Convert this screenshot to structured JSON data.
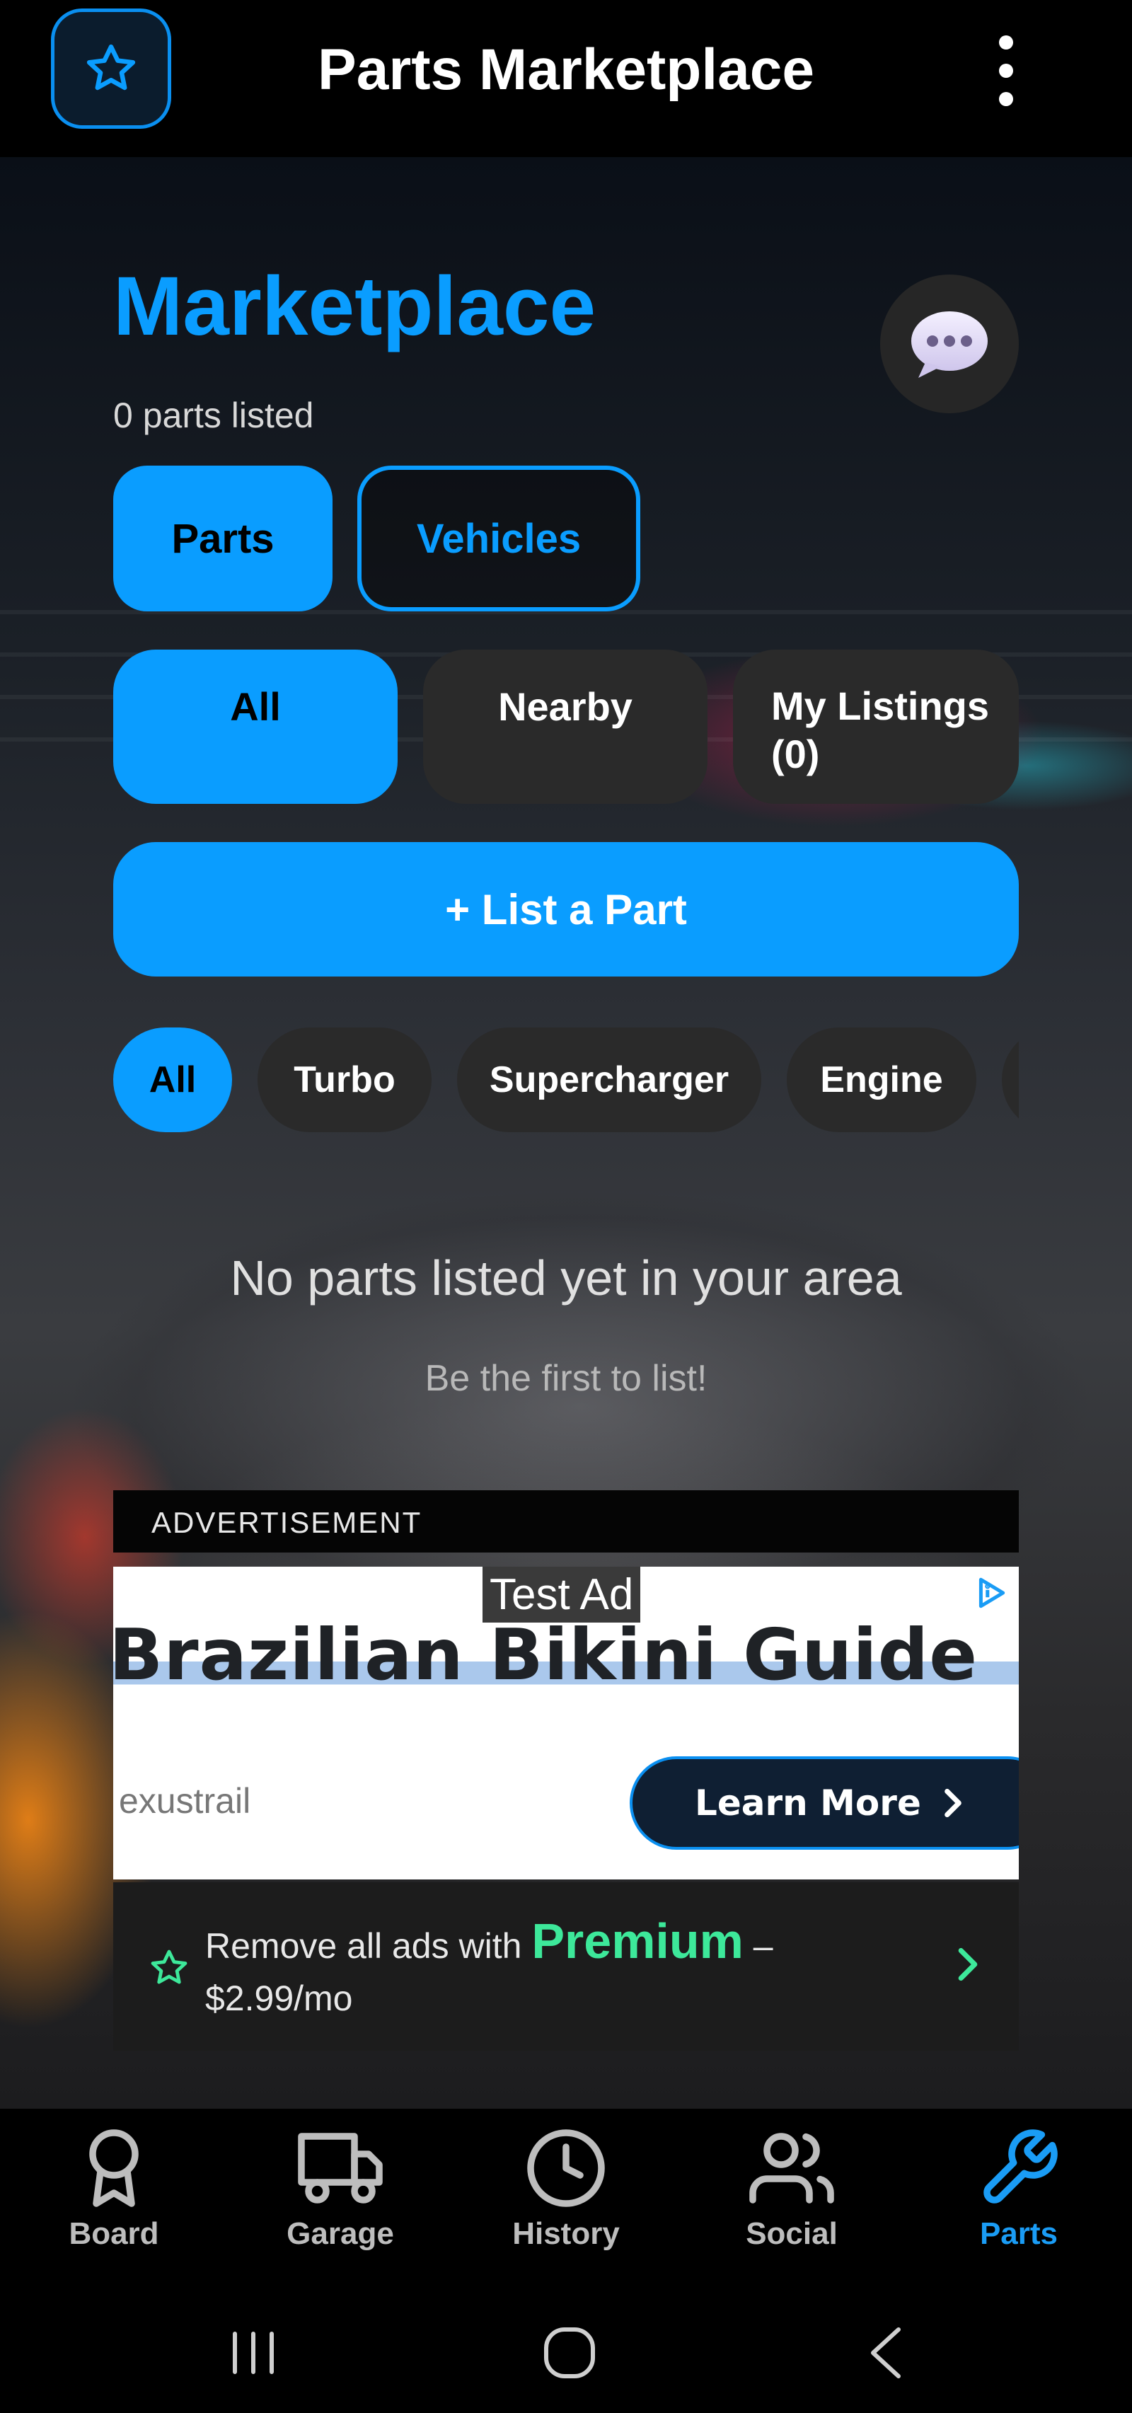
{
  "app_bar": {
    "title": "Parts Marketplace",
    "left_icon": "star-icon",
    "right_icon": "more-vertical-icon"
  },
  "header": {
    "title": "Marketplace",
    "count_text": "0 parts listed",
    "chat_icon": "chat-bubble-icon"
  },
  "segments": {
    "parts": "Parts",
    "vehicles": "Vehicles",
    "selected": "Parts"
  },
  "filters": {
    "all": "All",
    "nearby": "Nearby",
    "my_listings": "My Listings (0)",
    "selected": "All"
  },
  "cta": {
    "label": "+ List a Part"
  },
  "categories": {
    "items": [
      "All",
      "Turbo",
      "Supercharger",
      "Engine",
      ""
    ],
    "selected": "All"
  },
  "empty_state": {
    "title": "No parts listed yet in your area",
    "subtitle": "Be the first to list!"
  },
  "ad": {
    "header": "ADVERTISEMENT",
    "label": "Test Ad",
    "headline": "Brazilian Bikini Guide",
    "advertiser": "exustrail",
    "button": "Learn More"
  },
  "premium": {
    "prefix": "Remove all ads with",
    "highlight": "Premium",
    "suffix": " –",
    "price": "$2.99/mo"
  },
  "bottom_nav": {
    "items": [
      {
        "label": "Board",
        "icon": "award-icon"
      },
      {
        "label": "Garage",
        "icon": "truck-icon"
      },
      {
        "label": "History",
        "icon": "clock-icon"
      },
      {
        "label": "Social",
        "icon": "users-icon"
      },
      {
        "label": "Parts",
        "icon": "wrench-icon"
      }
    ],
    "active": "Parts"
  },
  "system_nav": {
    "icons": [
      "recents-icon",
      "home-icon",
      "back-icon"
    ]
  },
  "colors": {
    "accent": "#0a9dff",
    "premium": "#3de89a",
    "chip_bg": "#2a2a2a",
    "bar_bg": "#000000"
  }
}
